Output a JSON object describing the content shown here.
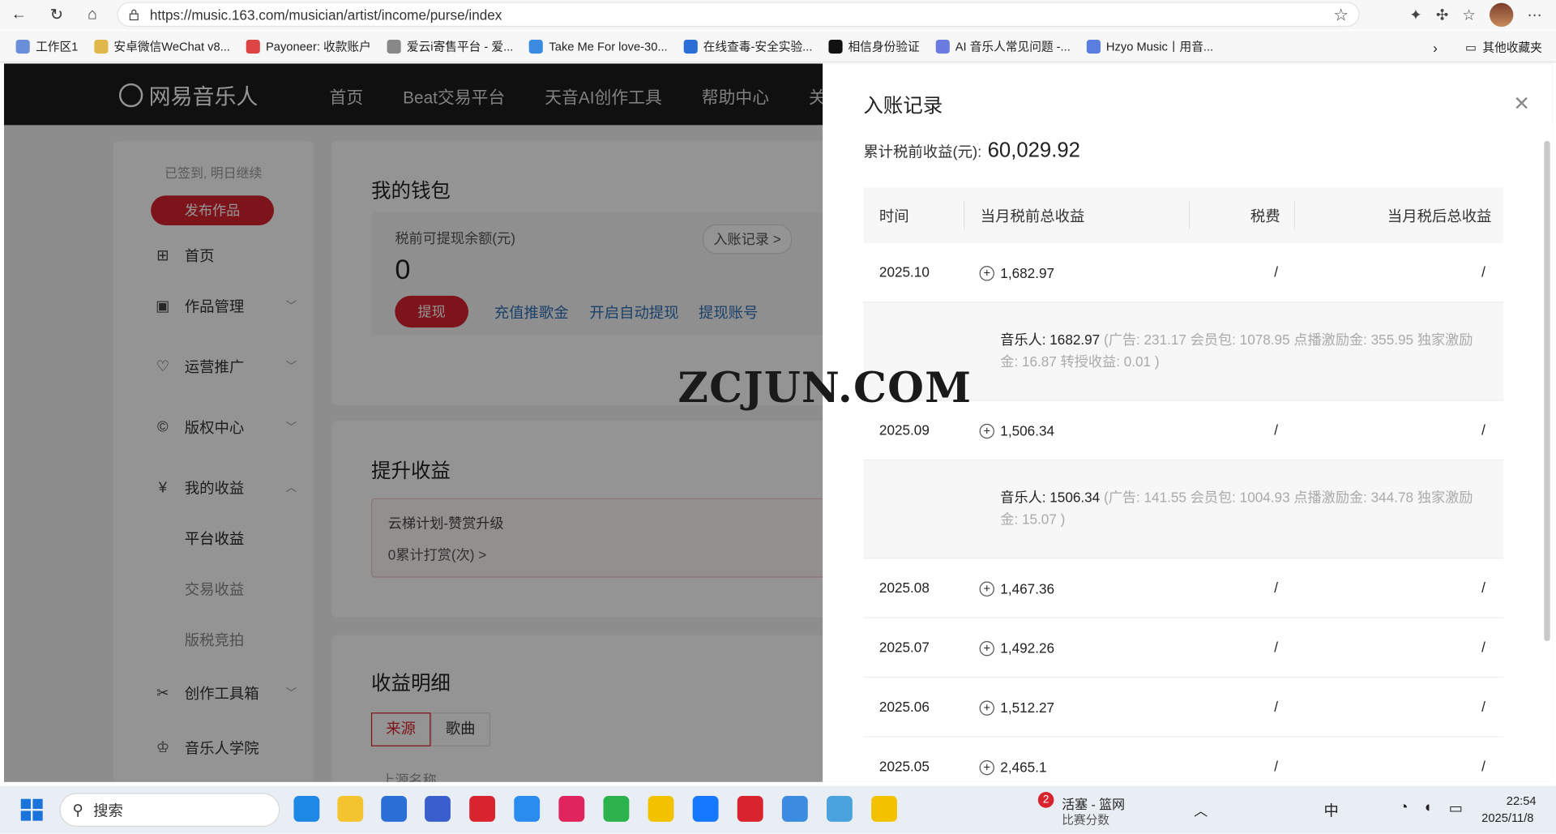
{
  "browser": {
    "url": "https://music.163.com/musician/artist/income/purse/index",
    "bookmarks": [
      "工作区1",
      "安卓微信WeChat v8...",
      "Payoneer: 收款账户",
      "爱云i寄售平台 - 爱...",
      "Take Me For love-30...",
      "在线查毒-安全实验...",
      "相信身份验证",
      "AI 音乐人常见问题 -...",
      "Hzyo Music丨用音..."
    ],
    "other_bookmarks": "其他收藏夹"
  },
  "site": {
    "logo": "网易音乐人",
    "nav": [
      "首页",
      "Beat交易平台",
      "天音AI创作工具",
      "帮助中心",
      "关于"
    ]
  },
  "sidebar": {
    "sign_text": "已签到, 明日继续",
    "publish": "发布作品",
    "items": [
      {
        "label": "首页",
        "icon": "grid-icon"
      },
      {
        "label": "作品管理",
        "icon": "works-icon"
      },
      {
        "label": "运营推广",
        "icon": "promo-icon"
      },
      {
        "label": "版权中心",
        "icon": "copyright-icon"
      },
      {
        "label": "我的收益",
        "icon": "yuan-icon"
      }
    ],
    "subitems": [
      "平台收益",
      "交易收益",
      "版税竞拍"
    ],
    "items2": [
      {
        "label": "创作工具箱",
        "icon": "tools-icon"
      },
      {
        "label": "音乐人学院",
        "icon": "academy-icon"
      }
    ]
  },
  "wallet": {
    "title": "我的钱包",
    "balance_label": "税前可提现余额(元)",
    "balance": "0",
    "withdraw": "提现",
    "links": [
      "充值推歌金",
      "开启自动提现",
      "提现账号"
    ],
    "income_records": "入账记录 >"
  },
  "boost": {
    "title": "提升收益",
    "plan": "云梯计划-赞赏升级",
    "count": "0累计打赏(次) >"
  },
  "detail": {
    "title": "收益明细",
    "tabs": [
      "来源",
      "歌曲"
    ],
    "partial": "上源名称"
  },
  "watermark": "ZCJUN.COM",
  "drawer": {
    "title": "入账记录",
    "total_label": "累计税前收益(元):",
    "total_value": "60,029.92",
    "columns": [
      "时间",
      "当月税前总收益",
      "税费",
      "当月税后总收益"
    ],
    "rows": [
      {
        "month": "2025.10",
        "pretax": "1,682.97",
        "tax": "/",
        "aftertax": "/",
        "detail_strong": "音乐人:  1682.97",
        "detail_rest": " (广告:  231.17 会员包:  1078.95 点播激励金:  355.95 独家激励金:  16.87 转授收益:  0.01 )"
      },
      {
        "month": "2025.09",
        "pretax": "1,506.34",
        "tax": "/",
        "aftertax": "/",
        "detail_strong": "音乐人:  1506.34",
        "detail_rest": " (广告:  141.55 会员包:  1004.93 点播激励金:  344.78 独家激励金:  15.07 )"
      },
      {
        "month": "2025.08",
        "pretax": "1,467.36",
        "tax": "/",
        "aftertax": "/"
      },
      {
        "month": "2025.07",
        "pretax": "1,492.26",
        "tax": "/",
        "aftertax": "/"
      },
      {
        "month": "2025.06",
        "pretax": "1,512.27",
        "tax": "/",
        "aftertax": "/"
      },
      {
        "month": "2025.05",
        "pretax": "2,465.1",
        "tax": "/",
        "aftertax": "/"
      }
    ]
  },
  "taskbar": {
    "search": "搜索",
    "news_title": "活塞 - 篮网",
    "news_sub": "比赛分数",
    "badge": "2",
    "ime": "中",
    "time": "22:54",
    "date": "2025/11/8"
  }
}
